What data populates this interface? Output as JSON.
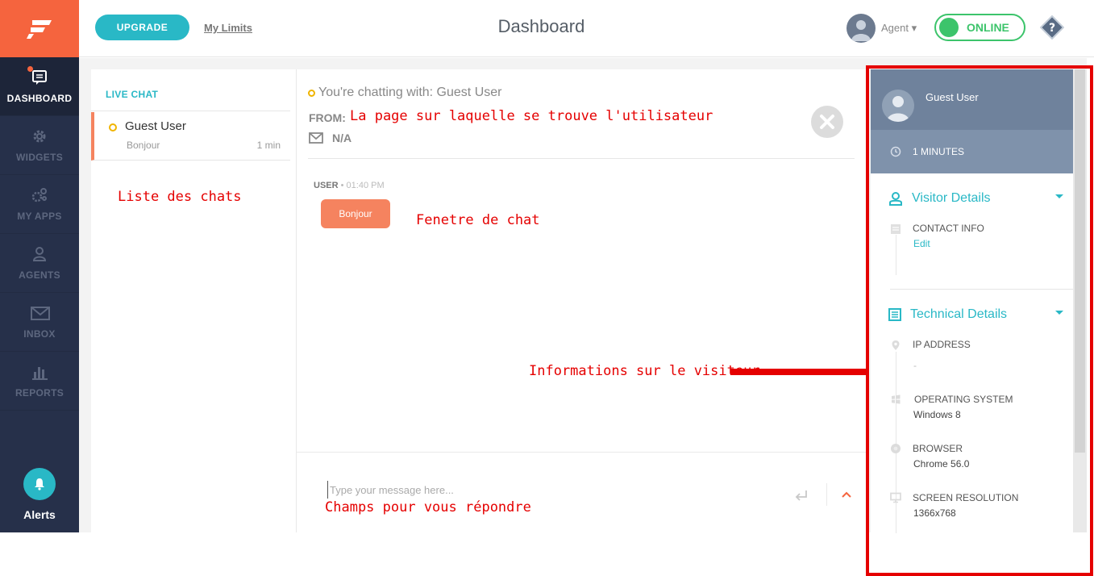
{
  "header": {
    "upgrade_label": "UPGRADE",
    "limits_label": "My Limits",
    "title": "Dashboard",
    "agent_label": "Agent ▾",
    "status_label": "ONLINE",
    "help_label": "?"
  },
  "sidebar": {
    "items": [
      {
        "label": "DASHBOARD",
        "icon": "dashboard-icon",
        "active": true
      },
      {
        "label": "WIDGETS",
        "icon": "gear-icon"
      },
      {
        "label": "MY APPS",
        "icon": "apps-icon"
      },
      {
        "label": "AGENTS",
        "icon": "agents-icon"
      },
      {
        "label": "INBOX",
        "icon": "envelope-icon"
      },
      {
        "label": "REPORTS",
        "icon": "bar-chart-icon"
      }
    ],
    "alerts_label": "Alerts"
  },
  "chat_list": {
    "heading": "LIVE CHAT",
    "chats": [
      {
        "name": "Guest User",
        "preview": "Bonjour",
        "time": "1 min"
      }
    ]
  },
  "chat_window": {
    "chatting_with": "You're chatting with: Guest User",
    "from_label": "FROM:",
    "email_value": "N/A",
    "messages": [
      {
        "sender": "USER",
        "time": "• 01:40 PM",
        "text": "Bonjour"
      }
    ],
    "input_placeholder": "Type your message here..."
  },
  "visitor": {
    "name": "Guest User",
    "duration": "1 MINUTES",
    "visitor_details_title": "Visitor Details",
    "contact_info_label": "CONTACT INFO",
    "edit_label": "Edit",
    "technical_details_title": "Technical Details",
    "ip_label": "IP ADDRESS",
    "ip_value": "-",
    "os_label": "OPERATING SYSTEM",
    "os_value": "Windows 8",
    "browser_label": "BROWSER",
    "browser_value": "Chrome 56.0",
    "resolution_label": "SCREEN RESOLUTION",
    "resolution_value": "1366x768"
  },
  "annotations": {
    "from_page": "La page sur laquelle se trouve l'utilisateur",
    "chat_list": "Liste des chats",
    "chat_window": "Fenetre de chat",
    "visitor_info": "Informations sur le visiteur",
    "reply_field": "Champs pour vous répondre"
  },
  "colors": {
    "brand_orange": "#f5643e",
    "sidebar_bg": "#26304a",
    "accent_teal": "#29b8c6",
    "online_green": "#3cc46b",
    "annotation_red": "#e50000"
  }
}
